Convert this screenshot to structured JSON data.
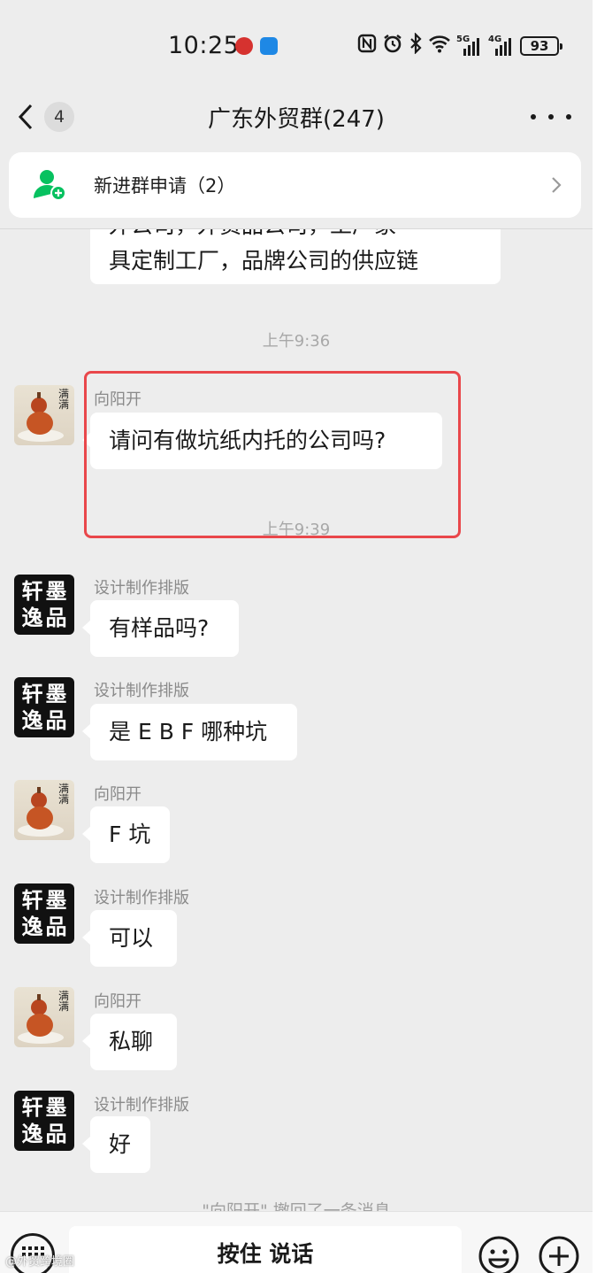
{
  "status_bar": {
    "time": "10:25",
    "network_labels": [
      "5G",
      "4G"
    ],
    "battery": "93",
    "icons": [
      "bank-app-icon",
      "cloud-app-icon",
      "nfc-icon",
      "alarm-icon",
      "bluetooth-icon",
      "wifi-icon",
      "signal-5g-icon",
      "signal-4g-icon",
      "battery-icon"
    ]
  },
  "nav": {
    "back_badge": "4",
    "title": "广东外贸群(247)"
  },
  "notice": {
    "text": "新进群申请（2）"
  },
  "chat": {
    "partial_message": {
      "line1": "外公司，外贸品公司，工厂家",
      "line2": "具定制工厂，品牌公司的供应链"
    },
    "timestamp1": "上午9:36",
    "timestamp2": "上午9:39",
    "messages": [
      {
        "sender": "向阳开",
        "text": "请问有做坑纸内托的公司吗?"
      },
      {
        "sender": "设计制作排版",
        "text": "有样品吗?"
      },
      {
        "sender": "设计制作排版",
        "text": "是 E B F 哪种坑"
      },
      {
        "sender": "向阳开",
        "text": "F 坑"
      },
      {
        "sender": "设计制作排版",
        "text": "可以"
      },
      {
        "sender": "向阳开",
        "text": "私聊"
      },
      {
        "sender": "设计制作排版",
        "text": "好"
      }
    ],
    "system_notice": "\"向阳开\" 撤回了一条消息",
    "avatar_ink_chars": [
      "轩",
      "墨",
      "逸",
      "品"
    ],
    "avatar_gourd_chars": "满满"
  },
  "input_bar": {
    "hold_to_talk": "按住 说话"
  },
  "watermark": "@外贸跨境圈",
  "colors": {
    "chat_bg": "#ededed",
    "bubble": "#ffffff",
    "highlight": "#e9474b",
    "notice_icon": "#07c160"
  }
}
